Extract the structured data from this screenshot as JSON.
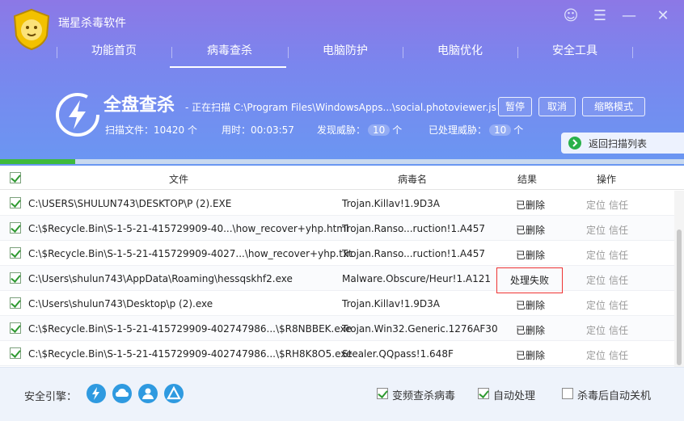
{
  "app": {
    "title": "瑞星杀毒软件"
  },
  "window_controls": [
    {
      "name": "user-icon",
      "glyph": "☺"
    },
    {
      "name": "menu-icon",
      "glyph": "☰"
    },
    {
      "name": "minimize-icon",
      "glyph": "—"
    },
    {
      "name": "close-icon",
      "glyph": "✕"
    }
  ],
  "nav": {
    "items": [
      {
        "label": "功能首页",
        "active": false
      },
      {
        "label": "病毒查杀",
        "active": true
      },
      {
        "label": "电脑防护",
        "active": false
      },
      {
        "label": "电脑优化",
        "active": false
      },
      {
        "label": "安全工具",
        "active": false
      }
    ]
  },
  "scan": {
    "title": "全盘查杀",
    "status": "- 正在扫描 C:\\Program Files\\WindowsApps...\\social.photoviewer.js",
    "buttons": {
      "pause": "暂停",
      "cancel": "取消",
      "mini": "缩略模式"
    },
    "stats": {
      "files_label": "扫描文件：",
      "files_value": "10420",
      "files_unit": "个",
      "time_label": "用时：",
      "time_value": "00:03:57",
      "threats_label": "发现威胁：",
      "threats_value": "10",
      "threats_unit": "个",
      "handled_label": "已处理威胁：",
      "handled_value": "10",
      "handled_unit": "个"
    },
    "back_label": "返回扫描列表",
    "progress": 0.11
  },
  "table": {
    "headers": {
      "file": "文件",
      "virus": "病毒名",
      "result": "结果",
      "action": "操作"
    },
    "rows": [
      {
        "file": "C:\\USERS\\SHULUN743\\DESKTOP\\P (2).EXE",
        "virus": "Trojan.Killav!1.9D3A",
        "result": "已删除",
        "locate": "定位",
        "trust": "信任"
      },
      {
        "file": "C:\\$Recycle.Bin\\S-1-5-21-415729909-40...\\how_recover+yhp.html",
        "virus": "Trojan.Ranso...ruction!1.A457",
        "result": "已删除",
        "locate": "定位",
        "trust": "信任"
      },
      {
        "file": "C:\\$Recycle.Bin\\S-1-5-21-415729909-4027...\\how_recover+yhp.txt",
        "virus": "Trojan.Ranso...ruction!1.A457",
        "result": "已删除",
        "locate": "定位",
        "trust": "信任"
      },
      {
        "file": "C:\\Users\\shulun743\\AppData\\Roaming\\hessqskhf2.exe",
        "virus": "Malware.Obscure/Heur!1.A121",
        "result": "处理失败",
        "locate": "定位",
        "trust": "信任",
        "failed": true
      },
      {
        "file": "C:\\Users\\shulun743\\Desktop\\p (2).exe",
        "virus": "Trojan.Killav!1.9D3A",
        "result": "已删除",
        "locate": "定位",
        "trust": "信任"
      },
      {
        "file": "C:\\$Recycle.Bin\\S-1-5-21-415729909-402747986...\\$R8NBBEK.exe",
        "virus": "Trojan.Win32.Generic.1276AF30",
        "result": "已删除",
        "locate": "定位",
        "trust": "信任"
      },
      {
        "file": "C:\\$Recycle.Bin\\S-1-5-21-415729909-402747986...\\$RH8K8O5.exe",
        "virus": "Stealer.QQpass!1.648F",
        "result": "已删除",
        "locate": "定位",
        "trust": "信任"
      }
    ]
  },
  "footer": {
    "engine_label": "安全引擎：",
    "engines": [
      "lightning-engine-icon",
      "cloud-engine-icon",
      "user-engine-icon",
      "triangle-engine-icon"
    ],
    "options": [
      {
        "label": "变频查杀病毒",
        "checked": true
      },
      {
        "label": "自动处理",
        "checked": true
      },
      {
        "label": "杀毒后自动关机",
        "checked": false
      }
    ]
  },
  "colors": {
    "header_top": "#8c78e6",
    "header_bottom": "#6a97f2",
    "progress": "#3fba3c",
    "fail_border": "#ee3333",
    "engine_icon": "#2f9ae0"
  }
}
